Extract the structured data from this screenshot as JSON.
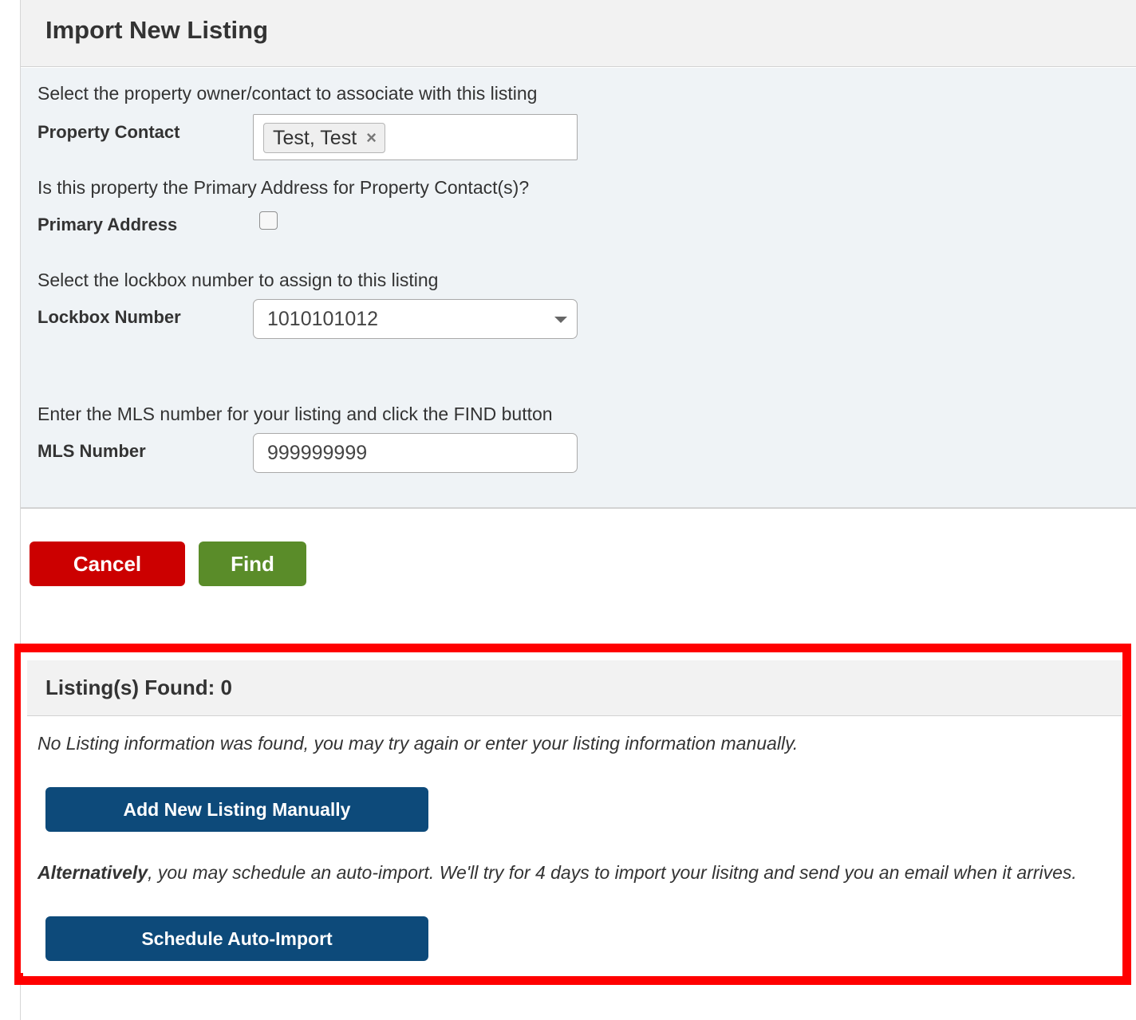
{
  "header": {
    "title": "Import New Listing"
  },
  "form": {
    "contact_prompt": "Select the property owner/contact to associate with this listing",
    "contact_label": "Property Contact",
    "contact_tag": "Test, Test",
    "contact_tag_remove": "×",
    "primary_prompt": "Is this property the Primary Address for Property Contact(s)?",
    "primary_label": "Primary Address",
    "primary_checked": false,
    "lockbox_prompt": "Select the lockbox number to assign to this listing",
    "lockbox_label": "Lockbox Number",
    "lockbox_value": "1010101012",
    "mls_prompt": "Enter the MLS number for your listing and click the FIND button",
    "mls_label": "MLS Number",
    "mls_value": "999999999"
  },
  "actions": {
    "cancel_label": "Cancel",
    "find_label": "Find"
  },
  "results": {
    "title": "Listing(s) Found: 0",
    "message": "No Listing information was found, you may try again or enter your listing information manually.",
    "add_manual_label": "Add New Listing Manually",
    "alt_strong": "Alternatively",
    "alt_text": ", you may schedule an auto-import. We'll try for 4 days to import your lisitng and send you an email when it arrives.",
    "schedule_label": "Schedule Auto-Import"
  },
  "colors": {
    "cancel": "#cc0000",
    "find": "#5a8c29",
    "primary_blue": "#0d4a7a",
    "highlight_frame": "#ff0000",
    "form_bg": "#eff3f6"
  },
  "icons": {
    "tag_remove": "close-icon",
    "select_caret": "caret-down-icon"
  }
}
